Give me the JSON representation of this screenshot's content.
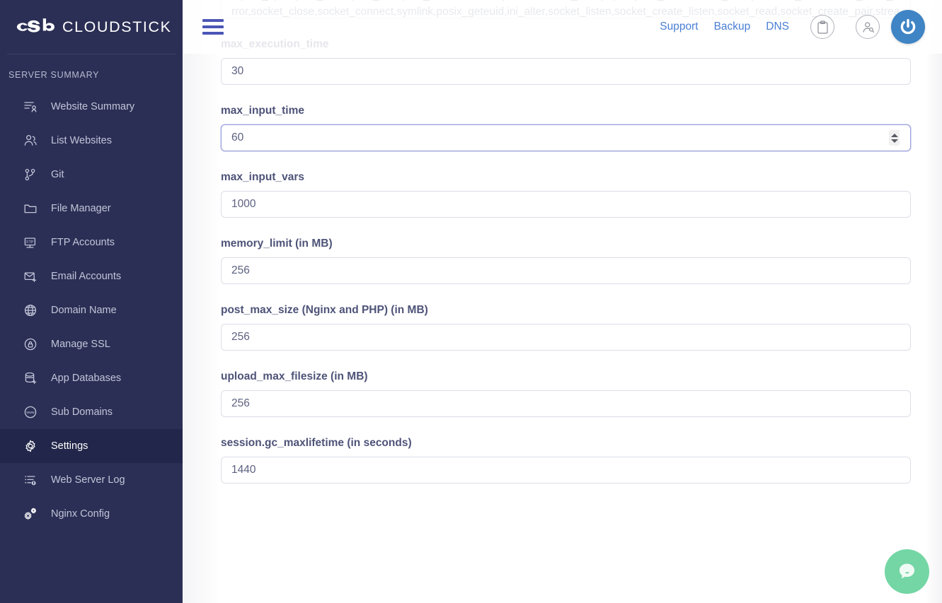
{
  "brand": {
    "name": "CLOUDSTICK",
    "logo_icon": "cloudstick-cloud-logo"
  },
  "sidebar": {
    "section_title": "SERVER SUMMARY",
    "items": [
      {
        "label": "Website Summary",
        "icon": "website-summary-icon",
        "active": false
      },
      {
        "label": "List Websites",
        "icon": "users-group-icon",
        "active": false
      },
      {
        "label": "Git",
        "icon": "git-branch-icon",
        "active": false
      },
      {
        "label": "File Manager",
        "icon": "folder-icon",
        "active": false
      },
      {
        "label": "FTP Accounts",
        "icon": "ftp-icon",
        "active": false
      },
      {
        "label": "Email Accounts",
        "icon": "email-add-icon",
        "active": false
      },
      {
        "label": "Domain Name",
        "icon": "globe-icon",
        "active": false
      },
      {
        "label": "Manage SSL",
        "icon": "lock-circle-icon",
        "active": false
      },
      {
        "label": "App Databases",
        "icon": "database-add-icon",
        "active": false
      },
      {
        "label": "Sub Domains",
        "icon": "www-circle-icon",
        "active": false
      },
      {
        "label": "Settings",
        "icon": "gear-icon",
        "active": true
      },
      {
        "label": "Web Server Log",
        "icon": "log-list-icon",
        "active": false
      },
      {
        "label": "Nginx Config",
        "icon": "gears-icon",
        "active": false
      }
    ]
  },
  "topbar": {
    "menu_icon": "hamburger-menu-icon",
    "links": [
      {
        "label": "Support"
      },
      {
        "label": "Backup"
      },
      {
        "label": "DNS"
      }
    ],
    "clipboard_icon": "clipboard-icon",
    "user_search_icon": "user-search-icon",
    "power_icon": "power-icon"
  },
  "main": {
    "disabled_functions": {
      "value": "l,posix_ctermid,posix_getcwd,posix_getegid,posix_geteuid,posix_getgid,posix_getgrgid,posix_getgrnam,posix_getgroups,posix_getlogin,posix_getpgid,posix_getpgrp,posix_getpid,posix,_getppid,posix_getpwuid,posix_getrlimit,posix_getsid,posix_getuid,posix_isatty,posix_kill,posix_mkfifo,posix_setegid,posix_seteuid,posix_setgid,posix_setpgid,posix_setsid,posix_setuid,posix_times,posix_ttyname,posix_uname,proc_open,proc_close,proc_nice,proc_terminate,escapeshellcmd,ini_alter,popen,pcntl_exec,socket_accept,socket_bind,socket_clear_error,socket_close,socket_connect,symlink,posix_geteuid,ini_alter,socket_listen,socket_create_listen,socket_read,socket_create_pair,stream_socket_server"
    },
    "fields": [
      {
        "label": "max_execution_time",
        "value": "30",
        "focused": false,
        "spinner": false
      },
      {
        "label": "max_input_time",
        "value": "60",
        "focused": true,
        "spinner": true
      },
      {
        "label": "max_input_vars",
        "value": "1000",
        "focused": false,
        "spinner": false
      },
      {
        "label": "memory_limit (in MB)",
        "value": "256",
        "focused": false,
        "spinner": false
      },
      {
        "label": "post_max_size (Nginx and PHP) (in MB)",
        "value": "256",
        "focused": false,
        "spinner": false
      },
      {
        "label": "upload_max_filesize (in MB)",
        "value": "256",
        "focused": false,
        "spinner": false
      },
      {
        "label": "session.gc_maxlifetime (in seconds)",
        "value": "1440",
        "focused": false,
        "spinner": false
      }
    ]
  },
  "chat": {
    "icon": "chat-bubble-icon"
  },
  "colors": {
    "sidebar_bg": "#2b2f55",
    "sidebar_active_bg": "#22264a",
    "accent_blue": "#4b56b5",
    "link_blue": "#4a7fd4",
    "power_blue": "#3f84c4",
    "chat_green": "#73d6a4",
    "label_text": "#4e5378",
    "input_text": "#5c6180"
  }
}
